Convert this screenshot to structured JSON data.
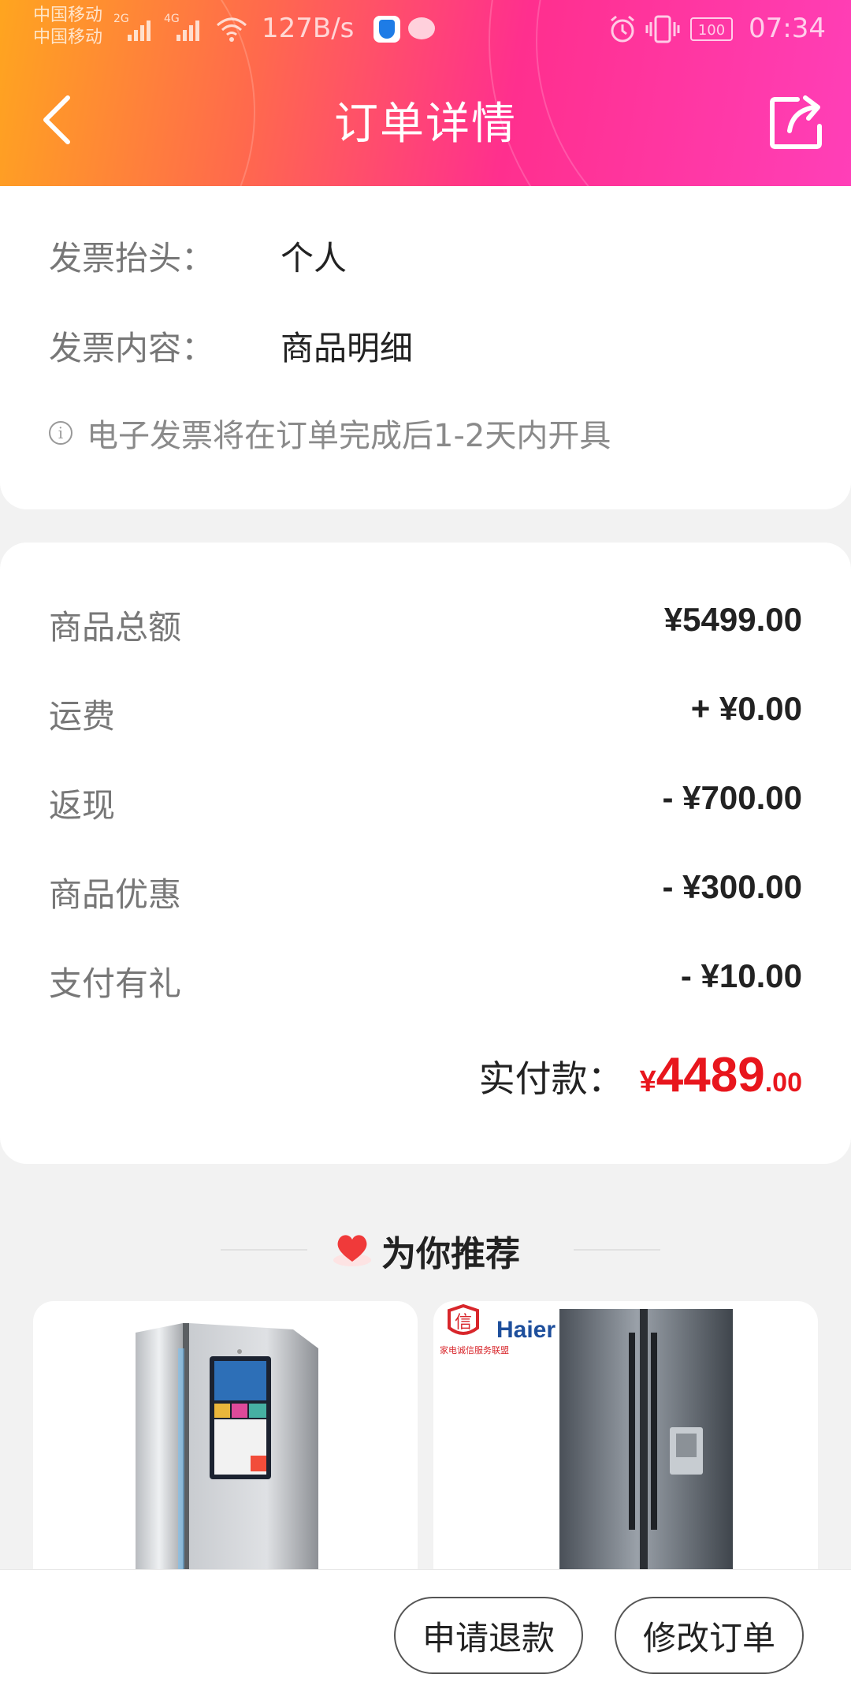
{
  "status_bar": {
    "carrier1": "中国移动",
    "carrier2": "中国移动",
    "net1": "2G",
    "net2": "4G",
    "speed": "127B/s",
    "battery": "100",
    "time": "07:34"
  },
  "header": {
    "title": "订单详情",
    "back_icon": "chevron-left-icon",
    "share_icon": "share-icon"
  },
  "invoice": {
    "title_label": "发票抬头：",
    "title_value": "个人",
    "content_label": "发票内容：",
    "content_value": "商品明细",
    "notice": "电子发票将在订单完成后1-2天内开具"
  },
  "amounts": {
    "rows": [
      {
        "label": "商品总额",
        "value": "¥5499.00"
      },
      {
        "label": "运费",
        "value": "+ ¥0.00"
      },
      {
        "label": "返现",
        "value": "- ¥700.00"
      },
      {
        "label": "商品优惠",
        "value": "- ¥300.00"
      },
      {
        "label": "支付有礼",
        "value": "- ¥10.00"
      }
    ],
    "paid_label": "实付款：",
    "paid_currency": "¥",
    "paid_int": "4489",
    "paid_dec": ".00"
  },
  "recommend": {
    "title": "为你推荐",
    "products": [
      {
        "image": "refrigerator-smart-screen"
      },
      {
        "image": "refrigerator-dark-steel",
        "badge": "家电诚信服务联盟",
        "brand": "Haier"
      }
    ]
  },
  "actions": {
    "refund": "申请退款",
    "modify": "修改订单"
  },
  "colors": {
    "accent_red": "#e8161d",
    "header_gradient_start": "#ffa51f",
    "header_gradient_end": "#ff3fb8"
  }
}
